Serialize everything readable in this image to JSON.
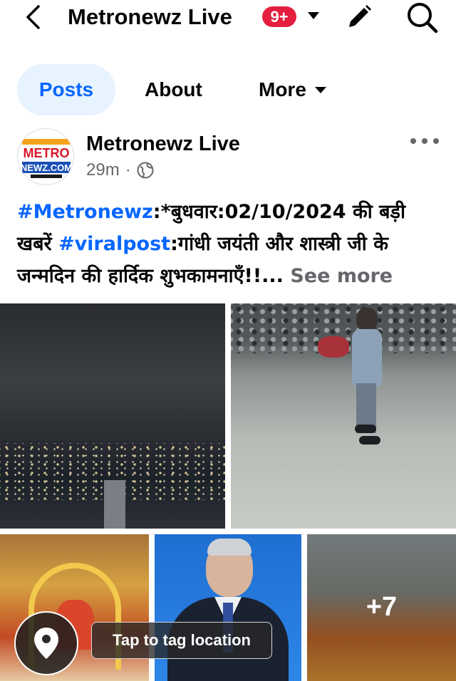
{
  "header": {
    "title": "Metronewz Live",
    "badge": "9+"
  },
  "tabs": [
    {
      "label": "Posts"
    },
    {
      "label": "About"
    },
    {
      "label": "More"
    }
  ],
  "post": {
    "author": "Metronewz Live",
    "time": "29m",
    "separator": "·",
    "text": {
      "tag1": "#Metronewz",
      "part1": ":*बुधवार:02/10/2024 की बड़ी खबरें ",
      "tag2": "#viralpost",
      "part2": ":गांधी जयंती और शास्त्री जी के जन्मदिन की हार्दिक शुभकामनाएँ!!...",
      "see_more": "See more"
    },
    "media": {
      "more_count": "+7"
    }
  },
  "overlay": {
    "tag_location": "Tap to tag location"
  },
  "icons": {
    "back": "chevron-left-icon",
    "caret": "caret-down-icon",
    "edit": "pencil-icon",
    "search": "search-icon",
    "globe": "globe-icon",
    "more_options": "more-options-icon",
    "location": "location-pin-icon"
  },
  "colors": {
    "accent": "#0866ff",
    "tab_active_bg": "#e7f3ff",
    "badge": "#e41e3f",
    "secondary_text": "#65676b"
  }
}
